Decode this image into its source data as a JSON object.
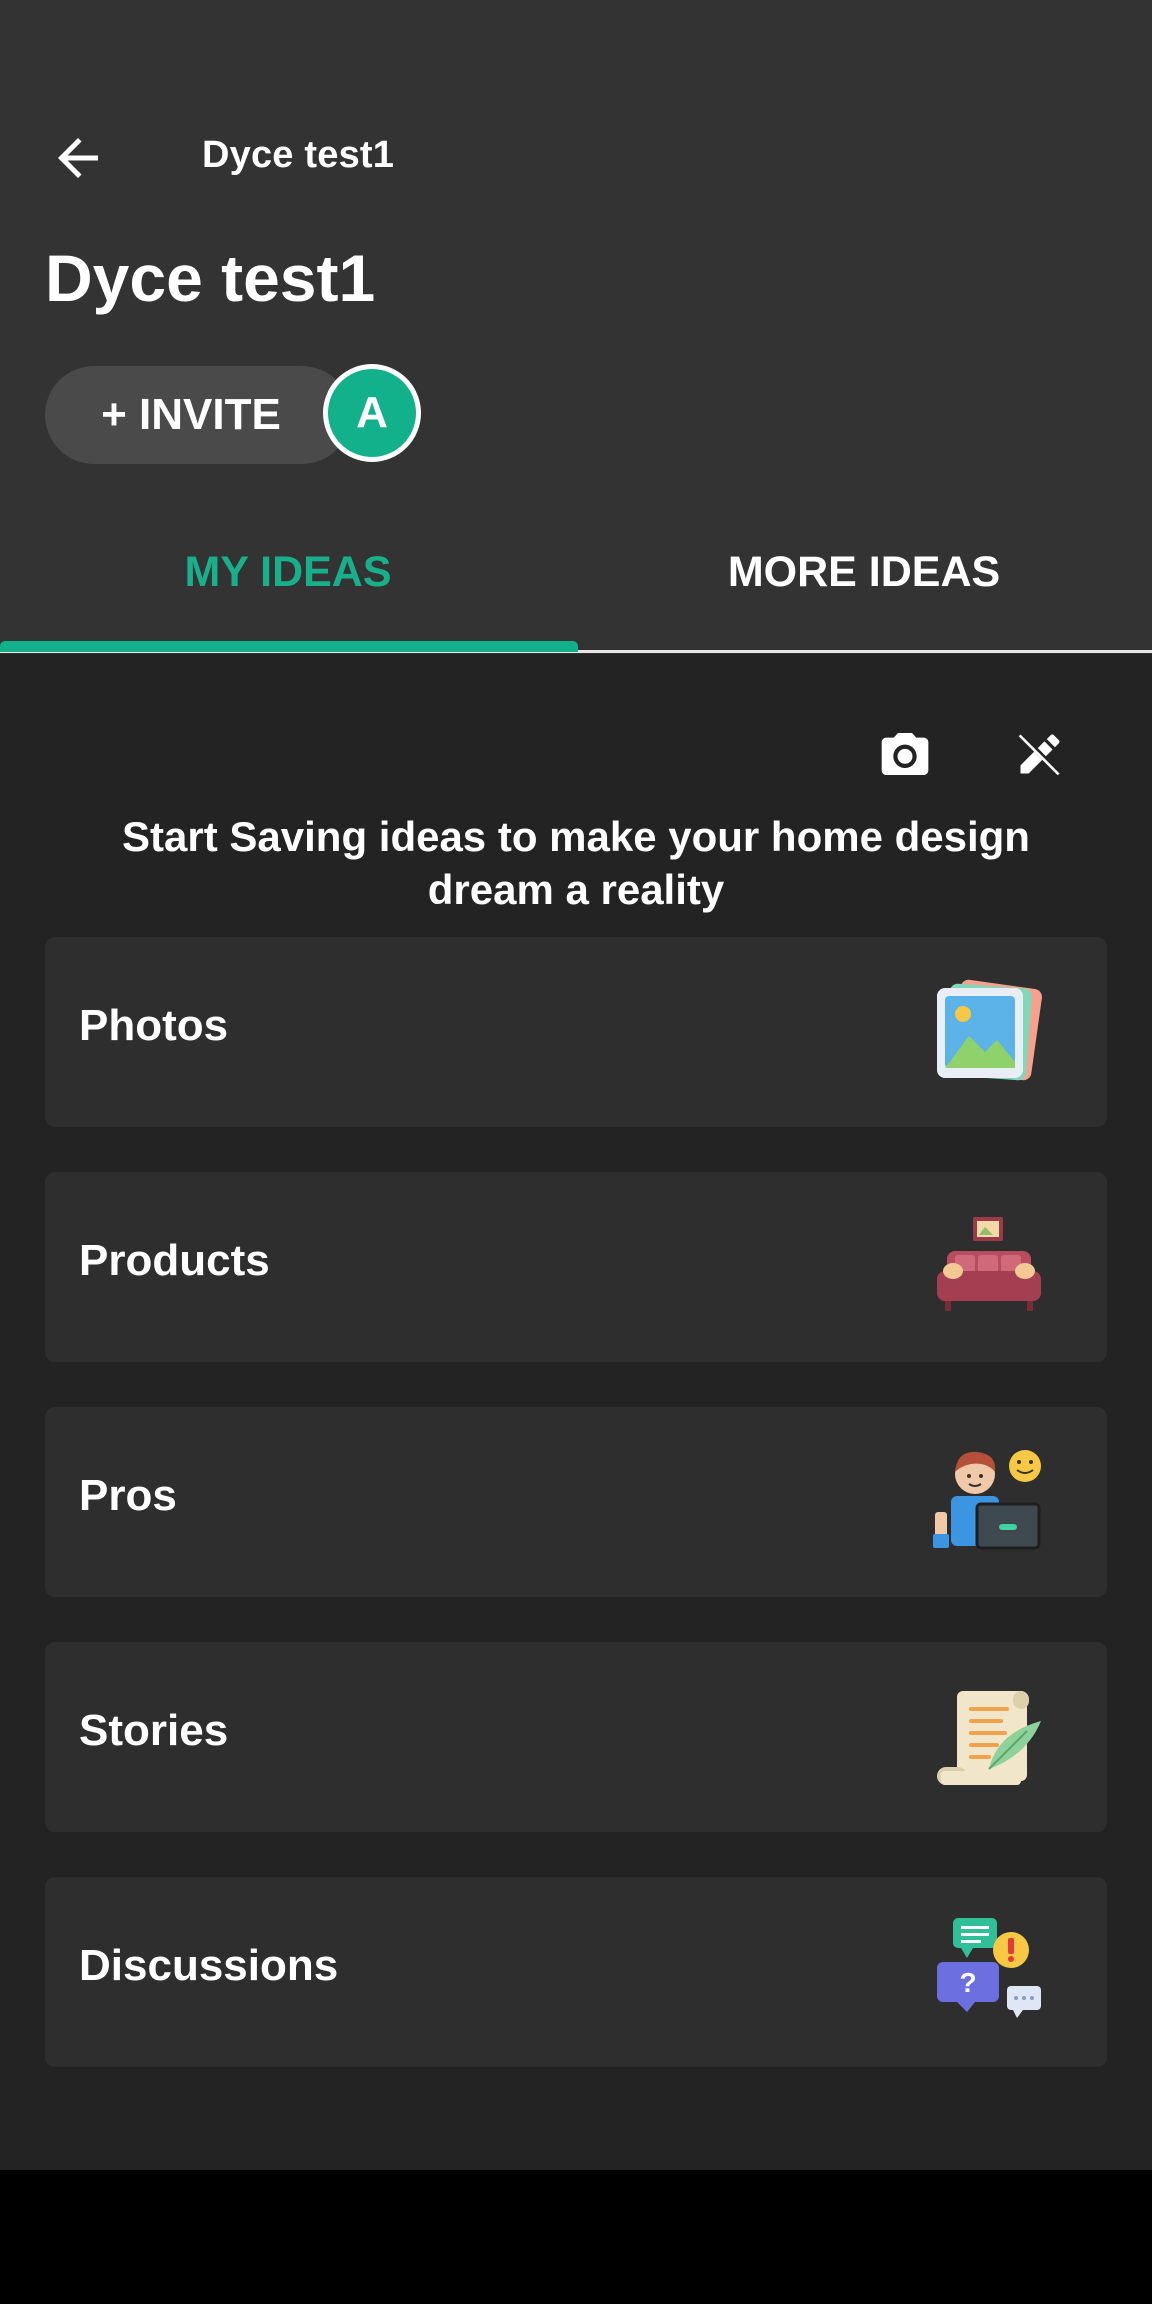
{
  "header": {
    "toolbar_title": "Dyce test1",
    "board_title": "Dyce test1",
    "invite_label": "+ INVITE",
    "avatar_initial": "A"
  },
  "tabs": [
    {
      "label": "MY IDEAS",
      "active": true
    },
    {
      "label": "MORE IDEAS",
      "active": false
    }
  ],
  "actions": {
    "camera_icon": "camera-icon",
    "edit_icon": "edit-pencil-icon"
  },
  "prompt": "Start Saving ideas to make your home design dream a reality",
  "categories": [
    {
      "label": "Photos",
      "icon": "photos-illustration-icon"
    },
    {
      "label": "Products",
      "icon": "sofa-illustration-icon"
    },
    {
      "label": "Pros",
      "icon": "professional-illustration-icon"
    },
    {
      "label": "Stories",
      "icon": "scroll-illustration-icon"
    },
    {
      "label": "Discussions",
      "icon": "chat-bubbles-illustration-icon"
    }
  ],
  "colors": {
    "accent": "#13b08c",
    "header_bg": "#333333",
    "content_bg": "#232323",
    "card_bg": "#2e2e2e"
  }
}
